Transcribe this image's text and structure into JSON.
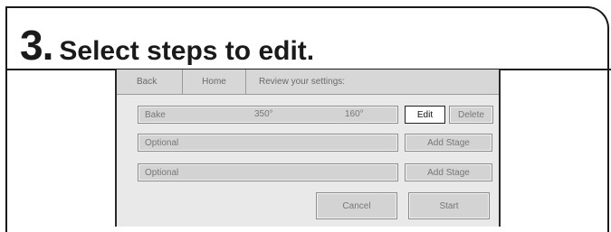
{
  "step": {
    "number": "3",
    "dot": ".",
    "title": "Select steps to edit."
  },
  "screen": {
    "topbar": {
      "back": "Back",
      "home": "Home",
      "review": "Review your settings:"
    },
    "stage1": {
      "name": "Bake",
      "temp_f": "350°",
      "temp_c": "160°",
      "edit": "Edit",
      "delete": "Delete"
    },
    "stage2": {
      "placeholder": "Optional",
      "add": "Add Stage"
    },
    "stage3": {
      "placeholder": "Optional",
      "add": "Add Stage"
    },
    "footer": {
      "cancel": "Cancel",
      "start": "Start"
    }
  },
  "colors": {
    "screen_bg": "#e9e9e9",
    "field_bg": "#d3d3d3",
    "active_btn_bg": "#ffffff"
  }
}
